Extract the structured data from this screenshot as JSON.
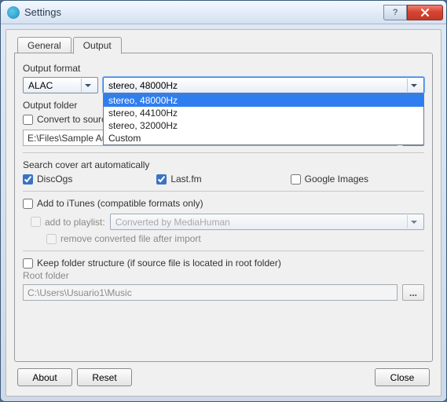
{
  "window": {
    "title": "Settings"
  },
  "tabs": {
    "general": "General",
    "output": "Output"
  },
  "outputFormat": {
    "label": "Output format",
    "codec": "ALAC",
    "selected": "stereo, 48000Hz",
    "options": [
      "stereo, 48000Hz",
      "stereo, 44100Hz",
      "stereo, 32000Hz",
      "Custom"
    ]
  },
  "outputFolder": {
    "label": "Output folder",
    "convertToSource": "Convert to source folder",
    "path": "E:\\Files\\Sample Audios"
  },
  "coverArt": {
    "label": "Search cover art automatically",
    "discogs": "DiscOgs",
    "lastfm": "Last.fm",
    "google": "Google Images"
  },
  "itunes": {
    "add": "Add to iTunes (compatible formats only)",
    "addPlaylist": "add to playlist:",
    "playlistName": "Converted by MediaHuman",
    "removeAfter": "remove converted file after import"
  },
  "rootFolder": {
    "keep": "Keep folder structure (if source file is located in root folder)",
    "label": "Root folder",
    "path": "C:\\Users\\Usuario1\\Music"
  },
  "buttons": {
    "about": "About",
    "reset": "Reset",
    "close": "Close",
    "browse": "..."
  }
}
